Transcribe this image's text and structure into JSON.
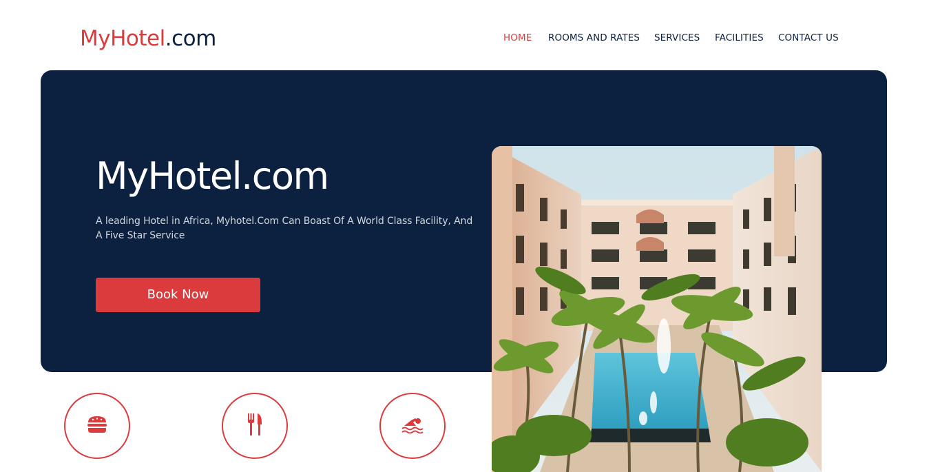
{
  "header": {
    "logo": {
      "brand": "MyHotel",
      "tld": ".com"
    },
    "nav": [
      {
        "label": "HOME",
        "active": true
      },
      {
        "label": "ROOMS AND RATES",
        "active": false
      },
      {
        "label": "SERVICES",
        "active": false
      },
      {
        "label": "FACILITIES",
        "active": false
      },
      {
        "label": "CONTACT US",
        "active": false
      }
    ]
  },
  "hero": {
    "title": "MyHotel.com",
    "description": "A leading Hotel in Africa, Myhotel.Com Can Boast Of A World Class Facility, And A Five Star Service",
    "cta_label": "Book Now",
    "image_subject": "hotel courtyard with palm trees and swimming pool"
  },
  "services": [
    {
      "icon": "burger-icon"
    },
    {
      "icon": "fork-knife-icon"
    },
    {
      "icon": "swimmer-icon"
    }
  ],
  "colors": {
    "accent": "#dc3b3d",
    "navy": "#0c213f",
    "background": "#ffffff"
  }
}
